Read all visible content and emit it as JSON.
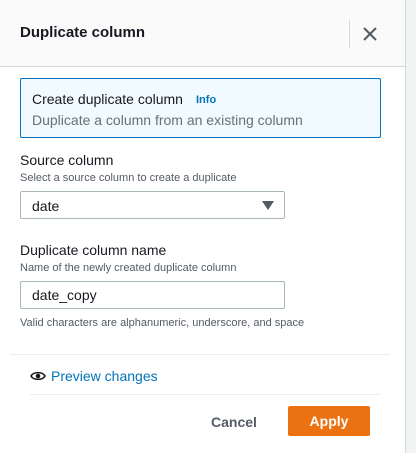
{
  "panel": {
    "title": "Duplicate column",
    "close_icon": "close-icon"
  },
  "info": {
    "title": "Create duplicate column",
    "link": "Info",
    "description": "Duplicate a column from an existing column"
  },
  "source": {
    "label": "Source column",
    "description": "Select a source column to create a duplicate",
    "selected": "date"
  },
  "duplicate": {
    "label": "Duplicate column name",
    "description": "Name of the newly created duplicate column",
    "value": "date_copy",
    "hint": "Valid characters are alphanumeric, underscore, and space"
  },
  "preview": {
    "label": "Preview changes",
    "icon": "eye-icon"
  },
  "actions": {
    "cancel": "Cancel",
    "apply": "Apply"
  },
  "colors": {
    "accent": "#0073bb",
    "primary_button": "#ec7211",
    "info_background": "#f1faff"
  }
}
